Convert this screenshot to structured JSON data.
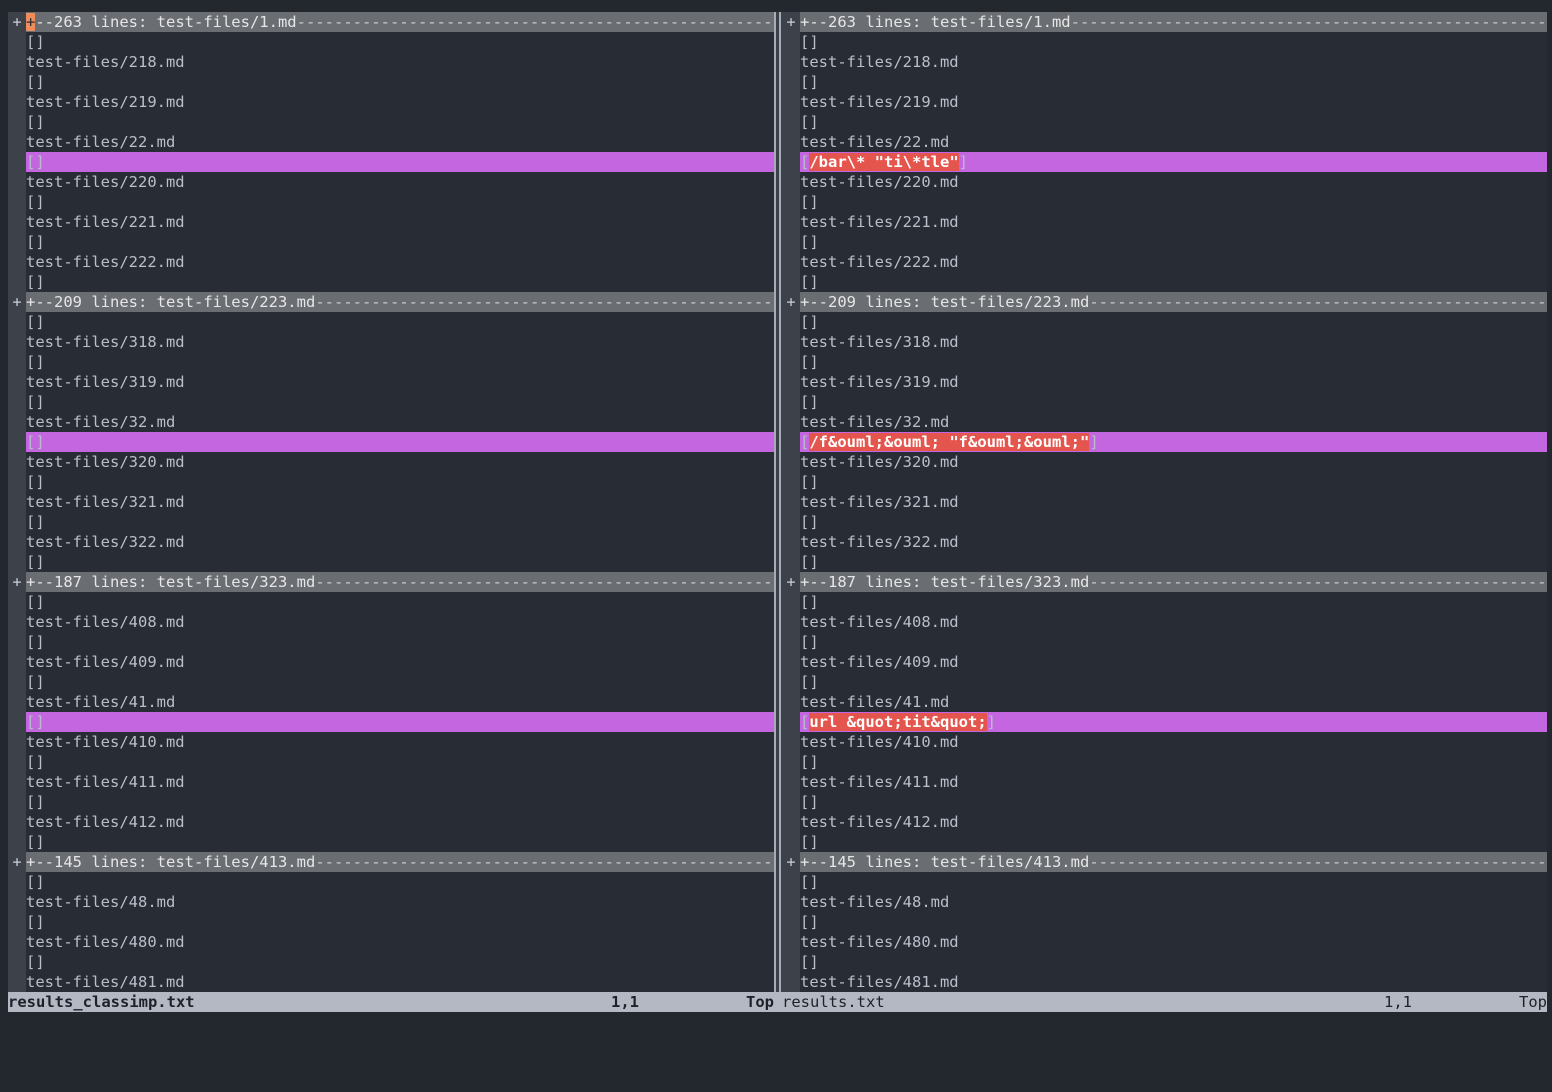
{
  "left": {
    "folds": [
      {
        "text": "--263 lines: test-files/1.md",
        "marker": "+",
        "open": "+"
      },
      {
        "text": "--209 lines: test-files/223.md",
        "marker": "+",
        "open": "+"
      },
      {
        "text": "--187 lines: test-files/323.md",
        "marker": "+",
        "open": "+"
      },
      {
        "text": "--145 lines: test-files/413.md",
        "marker": "+",
        "open": "+"
      }
    ],
    "blocks": [
      [
        "[]",
        "test-files/218.md",
        "[]",
        "test-files/219.md",
        "[]",
        "test-files/22.md",
        "[]",
        "test-files/220.md",
        "[]",
        "test-files/221.md",
        "[]",
        "test-files/222.md",
        "[]"
      ],
      [
        "[]",
        "test-files/318.md",
        "[]",
        "test-files/319.md",
        "[]",
        "test-files/32.md",
        "[]",
        "test-files/320.md",
        "[]",
        "test-files/321.md",
        "[]",
        "test-files/322.md",
        "[]"
      ],
      [
        "[]",
        "test-files/408.md",
        "[]",
        "test-files/409.md",
        "[]",
        "test-files/41.md",
        "[]",
        "test-files/410.md",
        "[]",
        "test-files/411.md",
        "[]",
        "test-files/412.md",
        "[]"
      ],
      [
        "[]",
        "test-files/48.md",
        "[]",
        "test-files/480.md",
        "[]",
        "test-files/481.md"
      ]
    ],
    "status": {
      "filename": "results_classimp.txt",
      "position": "1,1",
      "scroll": "Top"
    }
  },
  "right": {
    "folds": [
      {
        "text": "--263 lines: test-files/1.md",
        "marker": "+",
        "open": "+"
      },
      {
        "text": "--209 lines: test-files/223.md",
        "marker": "+",
        "open": "+"
      },
      {
        "text": "--187 lines: test-files/323.md",
        "marker": "+",
        "open": "+"
      },
      {
        "text": "--145 lines: test-files/413.md",
        "marker": "+",
        "open": "+"
      }
    ],
    "blocks": [
      [
        "[]",
        "test-files/218.md",
        "[]",
        "test-files/219.md",
        "[]",
        "test-files/22.md",
        "[/bar\\* \"ti\\*tle\"]",
        "test-files/220.md",
        "[]",
        "test-files/221.md",
        "[]",
        "test-files/222.md",
        "[]"
      ],
      [
        "[]",
        "test-files/318.md",
        "[]",
        "test-files/319.md",
        "[]",
        "test-files/32.md",
        "[/f&ouml;&ouml; \"f&ouml;&ouml;\"]",
        "test-files/320.md",
        "[]",
        "test-files/321.md",
        "[]",
        "test-files/322.md",
        "[]"
      ],
      [
        "[]",
        "test-files/408.md",
        "[]",
        "test-files/409.md",
        "[]",
        "test-files/41.md",
        "[url &quot;tit&quot;]",
        "test-files/410.md",
        "[]",
        "test-files/411.md",
        "[]",
        "test-files/412.md",
        "[]"
      ],
      [
        "[]",
        "test-files/48.md",
        "[]",
        "test-files/480.md",
        "[]",
        "test-files/481.md"
      ]
    ],
    "status": {
      "filename": "results.txt",
      "position": "1,1",
      "scroll": "Top"
    }
  },
  "diff_row_index": 6,
  "colors": {
    "background": "#282c34",
    "fold": "#6a6d72",
    "diff_line": "#c466e0",
    "diff_text": "#e4554d",
    "cursor": "#ef8c5b",
    "statusbar": "#b4b8c2"
  }
}
